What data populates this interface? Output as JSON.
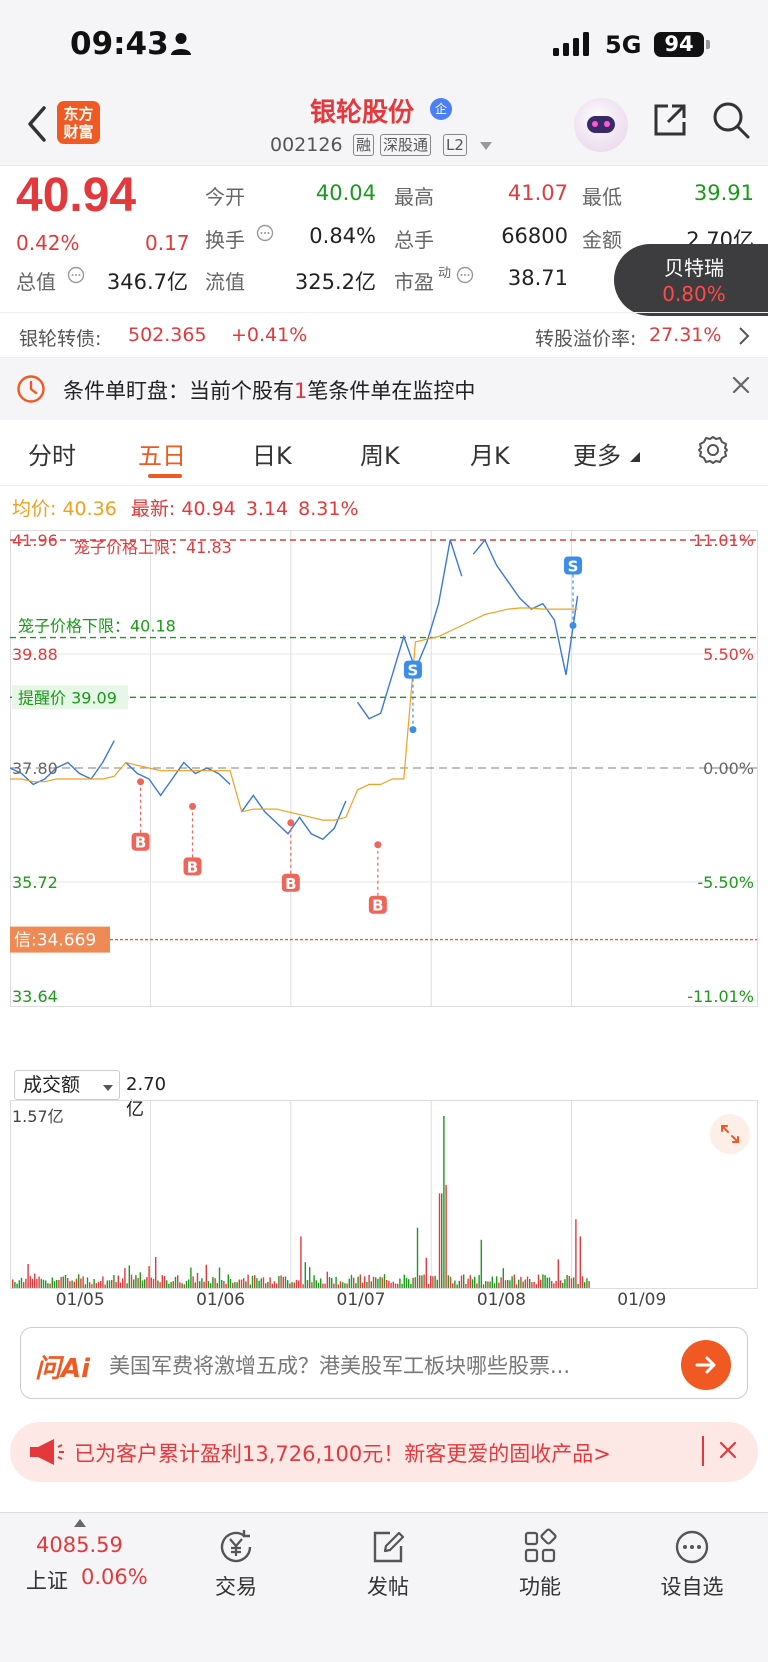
{
  "status_bar": {
    "time": "09:43",
    "network": "5G",
    "battery": "94"
  },
  "header": {
    "logo_line1": "东方",
    "logo_line2": "财富",
    "stock_name": "银轮股份",
    "company_badge": "企",
    "stock_code": "002126",
    "tags": [
      "融",
      "深股通",
      "L2"
    ]
  },
  "quote": {
    "price": "40.94",
    "change_pct": "0.42%",
    "change": "0.17",
    "open_label": "今开",
    "open": "40.04",
    "high_label": "最高",
    "high": "41.07",
    "low_label": "最低",
    "low": "39.91",
    "turnover_label": "换手",
    "turnover": "0.84%",
    "volume_label": "总手",
    "volume": "66800",
    "amount_label": "金额",
    "amount": "2.70亿",
    "mktcap_label": "总值",
    "mktcap": "346.7亿",
    "float_label": "流值",
    "float_cap": "325.2亿",
    "pe_label": "市盈",
    "pe_sup": "动",
    "pe": "38.71"
  },
  "floating_card": {
    "name": "贝特瑞",
    "pct": "0.80%"
  },
  "bond": {
    "name": "银轮转债:",
    "price": "502.365",
    "change": "+0.41%",
    "premium_label": "转股溢价率:",
    "premium": "27.31%"
  },
  "condition": {
    "text_before": "条件单盯盘：当前个股有",
    "count": "1",
    "text_after": "笔条件单在监控中"
  },
  "tabs": [
    {
      "label": "分时"
    },
    {
      "label": "五日"
    },
    {
      "label": "日K"
    },
    {
      "label": "周K"
    },
    {
      "label": "月K"
    },
    {
      "label": "更多"
    }
  ],
  "info_line": {
    "avg_label": "均价:",
    "avg": "40.36",
    "latest_label": "最新:",
    "latest": "40.94",
    "change": "3.14",
    "pct": "8.31%"
  },
  "chart_data": {
    "type": "line",
    "title": "",
    "x": [
      "01/05",
      "01/06",
      "01/07",
      "01/08",
      "01/09"
    ],
    "y_ticks_left": [
      "41.96",
      "39.88",
      "37.80",
      "35.72",
      "33.64"
    ],
    "y_ticks_right": [
      "11.01%",
      "5.50%",
      "0.00%",
      "-5.50%",
      "-11.01%"
    ],
    "ylim": [
      33.64,
      41.96
    ],
    "prev_close": 37.8,
    "series": [
      {
        "values": [
          37.8,
          37.7,
          37.5,
          37.6,
          37.8,
          37.9,
          37.7,
          37.6,
          37.9,
          38.3,
          37.9,
          37.7,
          37.6,
          37.3,
          37.6,
          37.9,
          37.7,
          37.8,
          37.7,
          37.5,
          37.0,
          37.3,
          37.0,
          36.8,
          36.6,
          36.9,
          36.6,
          36.5,
          36.7,
          37.2,
          39.0,
          38.7,
          38.8,
          39.5,
          40.2,
          39.6,
          40.1,
          40.8,
          41.96,
          41.3,
          41.7,
          41.96,
          41.5,
          41.2,
          40.9,
          40.7,
          40.8,
          40.5,
          39.5,
          40.94
        ]
      },
      {
        "values": [
          37.6,
          37.6,
          37.55,
          37.55,
          37.6,
          37.6,
          37.6,
          37.6,
          37.6,
          37.65,
          37.9,
          37.85,
          37.8,
          37.75,
          37.75,
          37.75,
          37.75,
          37.75,
          37.75,
          37.75,
          37.0,
          37.05,
          37.05,
          37.05,
          37.0,
          36.95,
          36.9,
          36.85,
          36.85,
          36.9,
          37.4,
          37.5,
          37.5,
          37.6,
          37.6,
          40.1,
          40.15,
          40.2,
          40.3,
          40.4,
          40.5,
          40.6,
          40.65,
          40.7,
          40.72,
          40.72,
          40.7,
          40.7,
          40.7,
          40.7
        ]
      }
    ],
    "limit_up_label": "笼子价格上限：41.83",
    "limit_down_label": "笼子价格下限：40.18",
    "alert_label": "提醒价 39.09",
    "limit_up": 41.83,
    "limit_down": 40.18,
    "alert": 39.09,
    "credit_label": "信:34.669",
    "credit": 34.669,
    "trades": [
      {
        "label": "B",
        "day": 0.93,
        "price": 37.55
      },
      {
        "label": "B",
        "day": 1.3,
        "price": 37.1
      },
      {
        "label": "B",
        "day": 2.0,
        "price": 36.8
      },
      {
        "label": "B",
        "day": 2.62,
        "price": 36.4
      },
      {
        "label": "S",
        "day": 2.87,
        "price": 38.5
      },
      {
        "label": "S",
        "day": 4.01,
        "price": 40.4
      }
    ]
  },
  "volume": {
    "selector_label": "成交额",
    "total": "2.70亿",
    "max_label": "1.57亿",
    "max": 1.57
  },
  "ask_ai": {
    "logo": "问Ai",
    "placeholder": "美国军费将激增五成？港美股军工板块哪些股票..."
  },
  "promo": {
    "text": "已为客户累计盈利13,726,100元！新客更爱的固收产品>"
  },
  "bottom_nav": {
    "index_value": "4085.59",
    "index_name": "上证",
    "index_pct": "0.06%",
    "items": [
      {
        "label": "交易"
      },
      {
        "label": "发帖"
      },
      {
        "label": "功能"
      },
      {
        "label": "设自选"
      }
    ]
  }
}
